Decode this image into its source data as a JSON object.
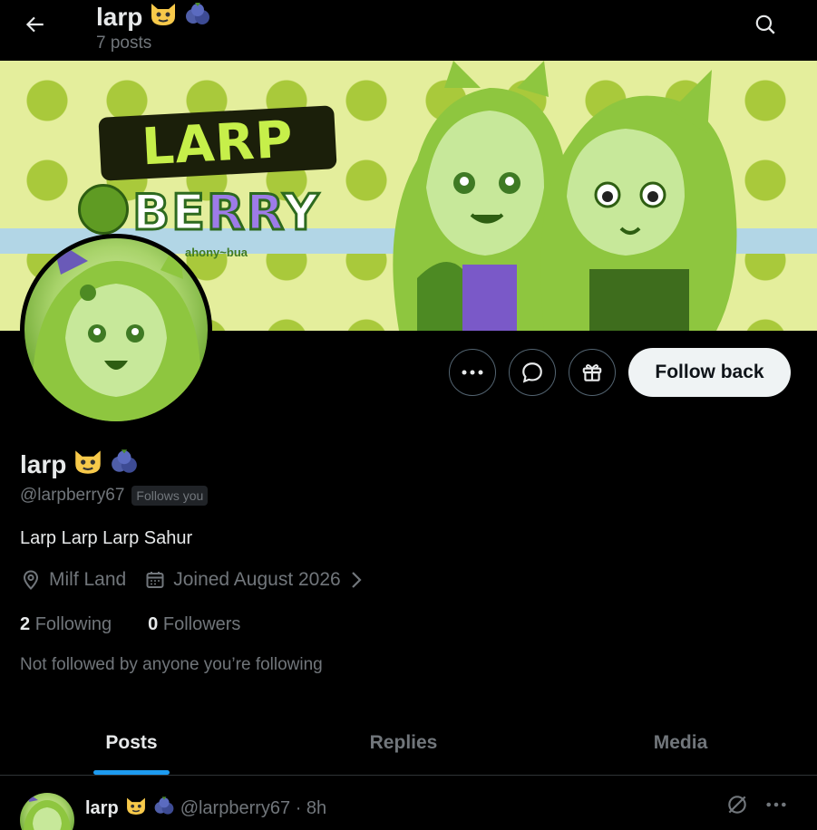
{
  "header": {
    "title": "larp",
    "post_count": "7 posts"
  },
  "banner": {
    "logo_top": "LARP",
    "logo_bottom_a": "BE",
    "logo_bottom_b": "RR",
    "logo_bottom_c": "Y",
    "logo_sub": "ahony~bua"
  },
  "actions": {
    "follow_label": "Follow back"
  },
  "profile": {
    "display_name": "larp",
    "handle": "@larpberry67",
    "follows_you": "Follows you",
    "bio": "Larp Larp Larp Sahur",
    "location": "Milf Land",
    "joined": "Joined August 2026",
    "following_count": "2",
    "following_label": "Following",
    "followers_count": "0",
    "followers_label": "Followers",
    "not_followed": "Not followed by anyone you’re following"
  },
  "tabs": [
    {
      "label": "Posts",
      "active": true
    },
    {
      "label": "Replies",
      "active": false
    },
    {
      "label": "Media",
      "active": false
    }
  ],
  "post": {
    "name": "larp",
    "handle_time": "@larpberry67 · 8h"
  },
  "colors": {
    "accent": "#1d9bf0",
    "muted": "#71767b",
    "text": "#e7e9ea"
  },
  "icons": [
    "back-arrow-icon",
    "search-icon",
    "more-icon",
    "message-icon",
    "gift-icon",
    "location-icon",
    "calendar-icon",
    "chevron-right-icon",
    "grok-icon"
  ]
}
